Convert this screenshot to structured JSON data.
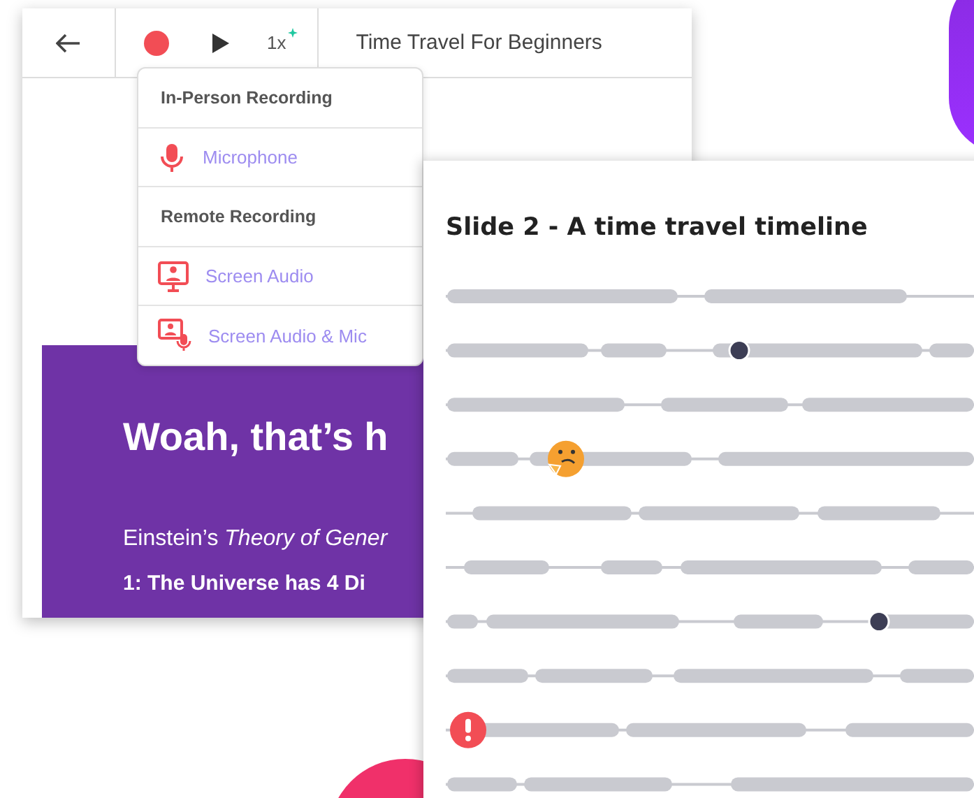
{
  "editor": {
    "toolbar": {
      "speed": "1x",
      "title": "Time Travel For Beginners"
    },
    "recording_menu": {
      "sections": [
        {
          "heading": "In-Person Recording",
          "items": [
            {
              "label": "Microphone",
              "kind": "mic"
            }
          ]
        },
        {
          "heading": "Remote Recording",
          "items": [
            {
              "label": "Screen Audio",
              "kind": "screen"
            },
            {
              "label": "Screen Audio & Mic",
              "kind": "screen_mic"
            }
          ]
        }
      ]
    },
    "slide": {
      "heading": "Woah, that’s h",
      "paragraph": "Einstein’s *Theory of Gener*",
      "point": "1: The Universe has 4 Di"
    }
  },
  "transcript_panel": {
    "title": "Slide 2 - A time travel timeline"
  }
}
